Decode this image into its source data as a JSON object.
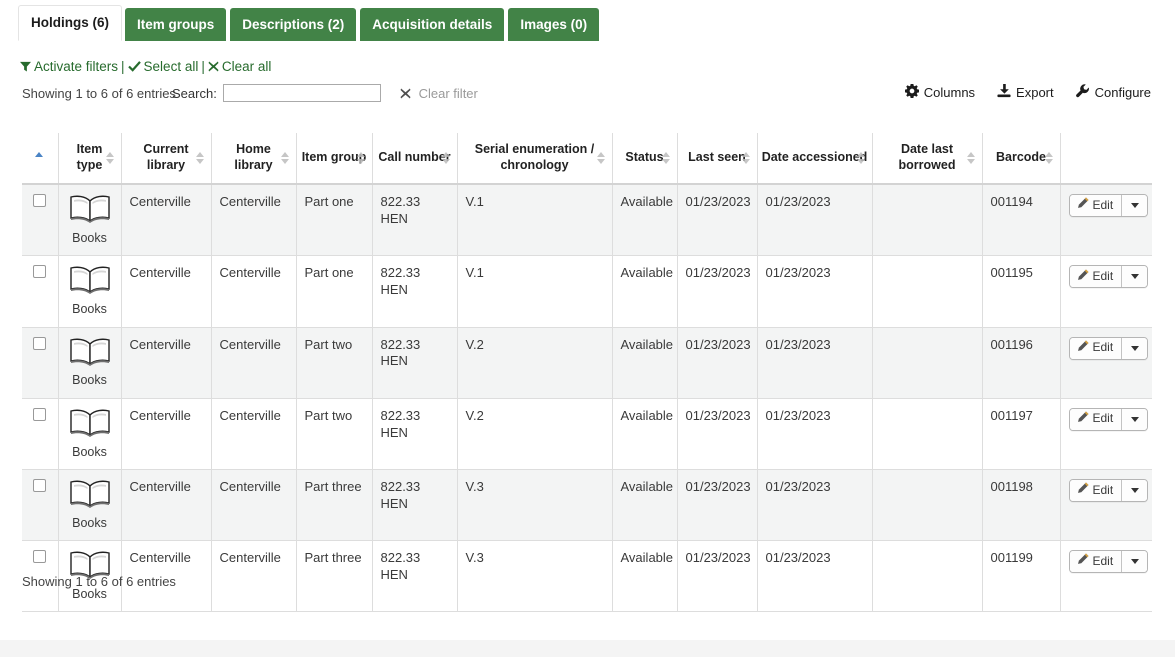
{
  "tabs": [
    {
      "label": "Holdings (6)",
      "active": true
    },
    {
      "label": "Item groups",
      "active": false
    },
    {
      "label": "Descriptions (2)",
      "active": false
    },
    {
      "label": "Acquisition details",
      "active": false
    },
    {
      "label": "Images (0)",
      "active": false
    }
  ],
  "filter_links": {
    "activate_filters": "Activate filters",
    "select_all": "Select all",
    "clear_all": "Clear all",
    "separator": "|"
  },
  "controls": {
    "showing_top": "Showing 1 to 6 of 6 entries",
    "search_label": "Search:",
    "search_value": "",
    "search_placeholder": "",
    "clear_filter": "Clear filter",
    "columns": "Columns",
    "export": "Export",
    "configure": "Configure"
  },
  "table": {
    "columns": [
      {
        "label": "",
        "sortable": true,
        "sorted": "asc"
      },
      {
        "label": "Item type",
        "sortable": true
      },
      {
        "label": "Current library",
        "sortable": true
      },
      {
        "label": "Home library",
        "sortable": true
      },
      {
        "label": "Item group",
        "sortable": true
      },
      {
        "label": "Call number",
        "sortable": true
      },
      {
        "label": "Serial enumeration / chronology",
        "sortable": true
      },
      {
        "label": "Status",
        "sortable": true
      },
      {
        "label": "Last seen",
        "sortable": true
      },
      {
        "label": "Date accessioned",
        "sortable": true
      },
      {
        "label": "Date last borrowed",
        "sortable": true
      },
      {
        "label": "Barcode",
        "sortable": true
      },
      {
        "label": "",
        "sortable": false
      }
    ],
    "rows": [
      {
        "item_type": "Books",
        "item_type_icon": "open-book-icon",
        "current_library": "Centerville",
        "home_library": "Centerville",
        "item_group": "Part one",
        "call_number": "822.33 HEN",
        "serial_enumeration": "V.1",
        "status": "Available",
        "last_seen": "01/23/2023",
        "date_accessioned": "01/23/2023",
        "date_last_borrowed": "",
        "barcode": "001194",
        "edit_label": "Edit"
      },
      {
        "item_type": "Books",
        "item_type_icon": "open-book-icon",
        "current_library": "Centerville",
        "home_library": "Centerville",
        "item_group": "Part one",
        "call_number": "822.33 HEN",
        "serial_enumeration": "V.1",
        "status": "Available",
        "last_seen": "01/23/2023",
        "date_accessioned": "01/23/2023",
        "date_last_borrowed": "",
        "barcode": "001195",
        "edit_label": "Edit"
      },
      {
        "item_type": "Books",
        "item_type_icon": "open-book-icon",
        "current_library": "Centerville",
        "home_library": "Centerville",
        "item_group": "Part two",
        "call_number": "822.33 HEN",
        "serial_enumeration": "V.2",
        "status": "Available",
        "last_seen": "01/23/2023",
        "date_accessioned": "01/23/2023",
        "date_last_borrowed": "",
        "barcode": "001196",
        "edit_label": "Edit"
      },
      {
        "item_type": "Books",
        "item_type_icon": "open-book-icon",
        "current_library": "Centerville",
        "home_library": "Centerville",
        "item_group": "Part two",
        "call_number": "822.33 HEN",
        "serial_enumeration": "V.2",
        "status": "Available",
        "last_seen": "01/23/2023",
        "date_accessioned": "01/23/2023",
        "date_last_borrowed": "",
        "barcode": "001197",
        "edit_label": "Edit"
      },
      {
        "item_type": "Books",
        "item_type_icon": "open-book-icon",
        "current_library": "Centerville",
        "home_library": "Centerville",
        "item_group": "Part three",
        "call_number": "822.33 HEN",
        "serial_enumeration": "V.3",
        "status": "Available",
        "last_seen": "01/23/2023",
        "date_accessioned": "01/23/2023",
        "date_last_borrowed": "",
        "barcode": "001198",
        "edit_label": "Edit"
      },
      {
        "item_type": "Books",
        "item_type_icon": "open-book-icon",
        "current_library": "Centerville",
        "home_library": "Centerville",
        "item_group": "Part three",
        "call_number": "822.33 HEN",
        "serial_enumeration": "V.3",
        "status": "Available",
        "last_seen": "01/23/2023",
        "date_accessioned": "01/23/2023",
        "date_last_borrowed": "",
        "barcode": "001199",
        "edit_label": "Edit"
      }
    ]
  },
  "footer": {
    "showing_bottom": "Showing 1 to 6 of 6 entries"
  },
  "colors": {
    "tab_green": "#428347",
    "link_green": "#276b2d",
    "barcode_green": "#2e7c36",
    "sort_active_blue": "#2a6ebb",
    "row_stripe": "#f3f4f4",
    "page_bg": "#f4f4f4"
  },
  "icons": {
    "filter": "filter-icon",
    "check": "check-icon",
    "x": "x-icon",
    "gear": "gear-icon",
    "download": "download-icon",
    "wrench": "wrench-icon",
    "pencil": "pencil-icon",
    "caret_down": "caret-down-icon"
  }
}
